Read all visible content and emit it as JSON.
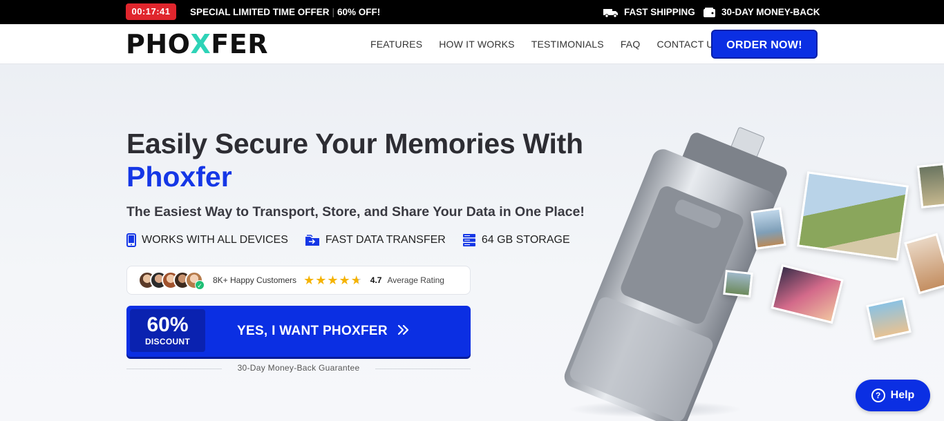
{
  "topbar": {
    "timer": "00:17:41",
    "offer_text": "SPECIAL LIMITED TIME OFFER",
    "offer_discount": "60% OFF!",
    "shipping": "FAST SHIPPING",
    "money_back": "30-DAY MONEY-BACK"
  },
  "nav": {
    "logo_start": "PHO",
    "logo_x": "X",
    "logo_end": "FER",
    "links": [
      "FEATURES",
      "HOW IT WORKS",
      "TESTIMONIALS",
      "FAQ",
      "CONTACT US"
    ],
    "order_button": "ORDER NOW!"
  },
  "hero": {
    "headline": "Easily Secure Your Memories With",
    "brand": "Phoxfer",
    "subheadline": "The Easiest Way to Transport, Store, and Share Your Data in One Place!",
    "features": [
      {
        "icon": "phone-icon",
        "label": "WORKS WITH ALL DEVICES"
      },
      {
        "icon": "folder-transfer-icon",
        "label": "FAST DATA TRANSFER"
      },
      {
        "icon": "storage-icon",
        "label": "64 GB STORAGE"
      }
    ],
    "social_proof": {
      "customers": "8K+ Happy Customers",
      "rating": "4.7",
      "rating_label": "Average Rating",
      "stars": 4.7
    },
    "cta": {
      "percent": "60%",
      "discount": "DISCOUNT",
      "label": "YES, I WANT PHOXFER"
    },
    "guarantee": "30-Day Money-Back Guarantee"
  },
  "help": {
    "label": "Help"
  },
  "colors": {
    "brand_blue": "#0b2fe3",
    "timer_red": "#e0262d",
    "logo_accent": "#2ed3b7",
    "star": "#f5b301"
  }
}
